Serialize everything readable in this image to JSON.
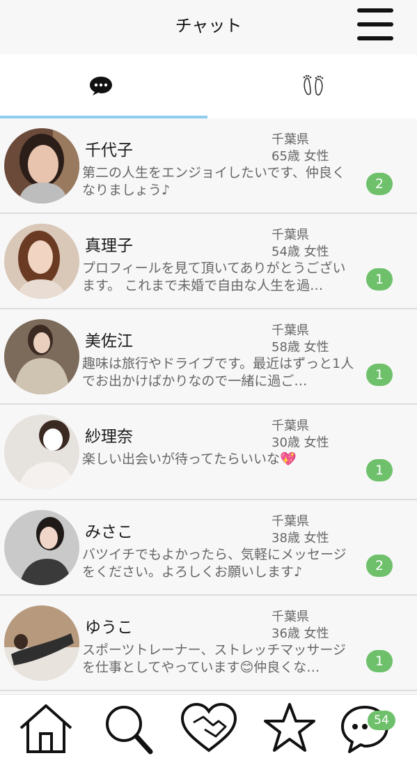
{
  "header": {
    "title": "チャット"
  },
  "tabs": [
    {
      "name": "chat",
      "icon": "chat-bubble-icon"
    },
    {
      "name": "footprints",
      "icon": "footprints-icon"
    }
  ],
  "accent_color": "#8ecdee",
  "badge_color": "#6ec06b",
  "chats": [
    {
      "name": "千代子",
      "prefecture": "千葉県",
      "age_sex": "65歳 女性",
      "message": "第二の人生をエンジョイしたいです、仲良くなりましょう♪",
      "unread": "2"
    },
    {
      "name": "真理子",
      "prefecture": "千葉県",
      "age_sex": "54歳 女性",
      "message": "プロフィールを見て頂いてありがとうございます。 これまで未婚で自由な人生を過…",
      "unread": "1"
    },
    {
      "name": "美佐江",
      "prefecture": "千葉県",
      "age_sex": "58歳 女性",
      "message": "趣味は旅行やドライブです。最近はずっと1人でお出かけばかりなので一緒に過ご…",
      "unread": "1"
    },
    {
      "name": "紗理奈",
      "prefecture": "千葉県",
      "age_sex": "30歳 女性",
      "message": "楽しい出会いが待ってたらいいな💖",
      "unread": "1"
    },
    {
      "name": "みさこ",
      "prefecture": "千葉県",
      "age_sex": "38歳 女性",
      "message": "バツイチでもよかったら、気軽にメッセージをください。よろしくお願いします♪",
      "unread": "2"
    },
    {
      "name": "ゆうこ",
      "prefecture": "千葉県",
      "age_sex": "36歳 女性",
      "message": "スポーツトレーナー、ストレッチマッサージを仕事としてやっています😊仲良くな…",
      "unread": "1"
    }
  ],
  "bottom_nav": {
    "items": [
      "home-icon",
      "search-icon",
      "heart-handshake-icon",
      "star-icon",
      "chat-icon"
    ],
    "chat_badge": "54"
  }
}
